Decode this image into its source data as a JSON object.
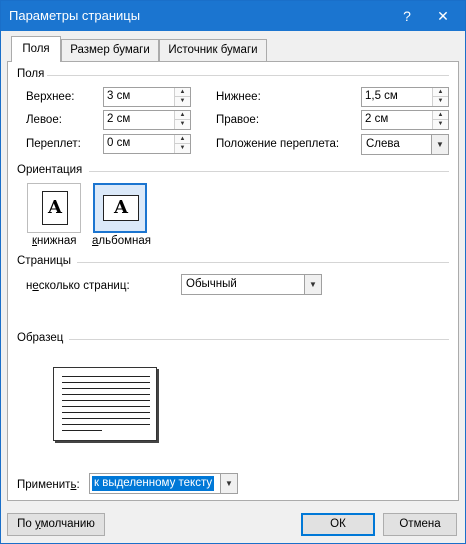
{
  "window": {
    "title": "Параметры страницы",
    "help_glyph": "?",
    "close_glyph": "✕"
  },
  "tabs": [
    "Поля",
    "Размер бумаги",
    "Источник бумаги"
  ],
  "margins": {
    "section_title": "Поля",
    "top_label": "Верхнее:",
    "top_value": "3 см",
    "bottom_label": "Нижнее:",
    "bottom_value": "1,5 см",
    "left_label": "Левое:",
    "left_value": "2 см",
    "right_label": "Правое:",
    "right_value": "2 см",
    "gutter_label": "Переплет:",
    "gutter_value": "0 см",
    "gutter_pos_label": "Положение переплета:",
    "gutter_pos_value": "Слева"
  },
  "orientation": {
    "section_title": "Ориентация",
    "portrait_label": "книжная",
    "landscape_label": "альбомная",
    "glyph": "A",
    "selected": "landscape"
  },
  "pages": {
    "section_title": "Страницы",
    "multiple_label": "несколько страниц:",
    "multiple_value": "Обычный"
  },
  "preview": {
    "section_title": "Образец"
  },
  "apply": {
    "label": "Применить:",
    "value": "к выделенному тексту"
  },
  "buttons": {
    "default": "По умолчанию",
    "ok": "ОК",
    "cancel": "Отмена"
  },
  "icons": {
    "spin_up": "▲",
    "spin_down": "▼",
    "dropdown": "▼"
  }
}
